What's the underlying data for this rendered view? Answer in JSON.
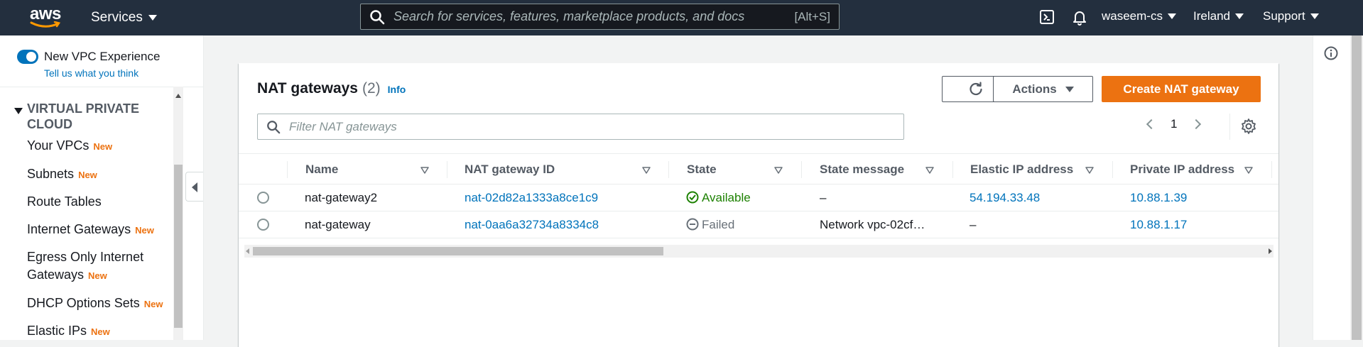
{
  "topnav": {
    "logo_text": "aws",
    "services_label": "Services",
    "search_placeholder": "Search for services, features, marketplace products, and docs",
    "search_shortcut": "[Alt+S]",
    "account_label": "waseem-cs",
    "region_label": "Ireland",
    "support_label": "Support"
  },
  "sidebar": {
    "vpc_experience_label": "New VPC Experience",
    "tell_us_link": "Tell us what you think",
    "section_title": "VIRTUAL PRIVATE CLOUD",
    "new_badge": "New",
    "items": [
      {
        "label": "Your VPCs",
        "badge": "New"
      },
      {
        "label": "Subnets",
        "badge": "New"
      },
      {
        "label": "Route Tables",
        "badge": ""
      },
      {
        "label": "Internet Gateways",
        "badge": "New"
      },
      {
        "label": "Egress Only Internet Gateways",
        "badge": "New"
      },
      {
        "label": "DHCP Options Sets",
        "badge": "New"
      },
      {
        "label": "Elastic IPs",
        "badge": "New"
      }
    ]
  },
  "panel": {
    "title": "NAT gateways",
    "count": "(2)",
    "info_link": "Info",
    "actions_label": "Actions",
    "create_label": "Create NAT gateway",
    "filter_placeholder": "Filter NAT gateways",
    "page_number": "1"
  },
  "table": {
    "columns": [
      "Name",
      "NAT gateway ID",
      "State",
      "State message",
      "Elastic IP address",
      "Private IP address"
    ],
    "rows": [
      {
        "name": "nat-gateway2",
        "id": "nat-02d82a1333a8ce1c9",
        "state": "Available",
        "message": "–",
        "elastic_ip": "54.194.33.48",
        "private_ip": "10.88.1.39"
      },
      {
        "name": "nat-gateway",
        "id": "nat-0aa6a32734a8334c8",
        "state": "Failed",
        "message": "Network vpc-02cf…",
        "elastic_ip": "–",
        "private_ip": "10.88.1.17"
      }
    ]
  },
  "colors": {
    "nav_bg": "#232f3e",
    "primary": "#ec7211",
    "link": "#0073bb",
    "success": "#1d8102"
  }
}
